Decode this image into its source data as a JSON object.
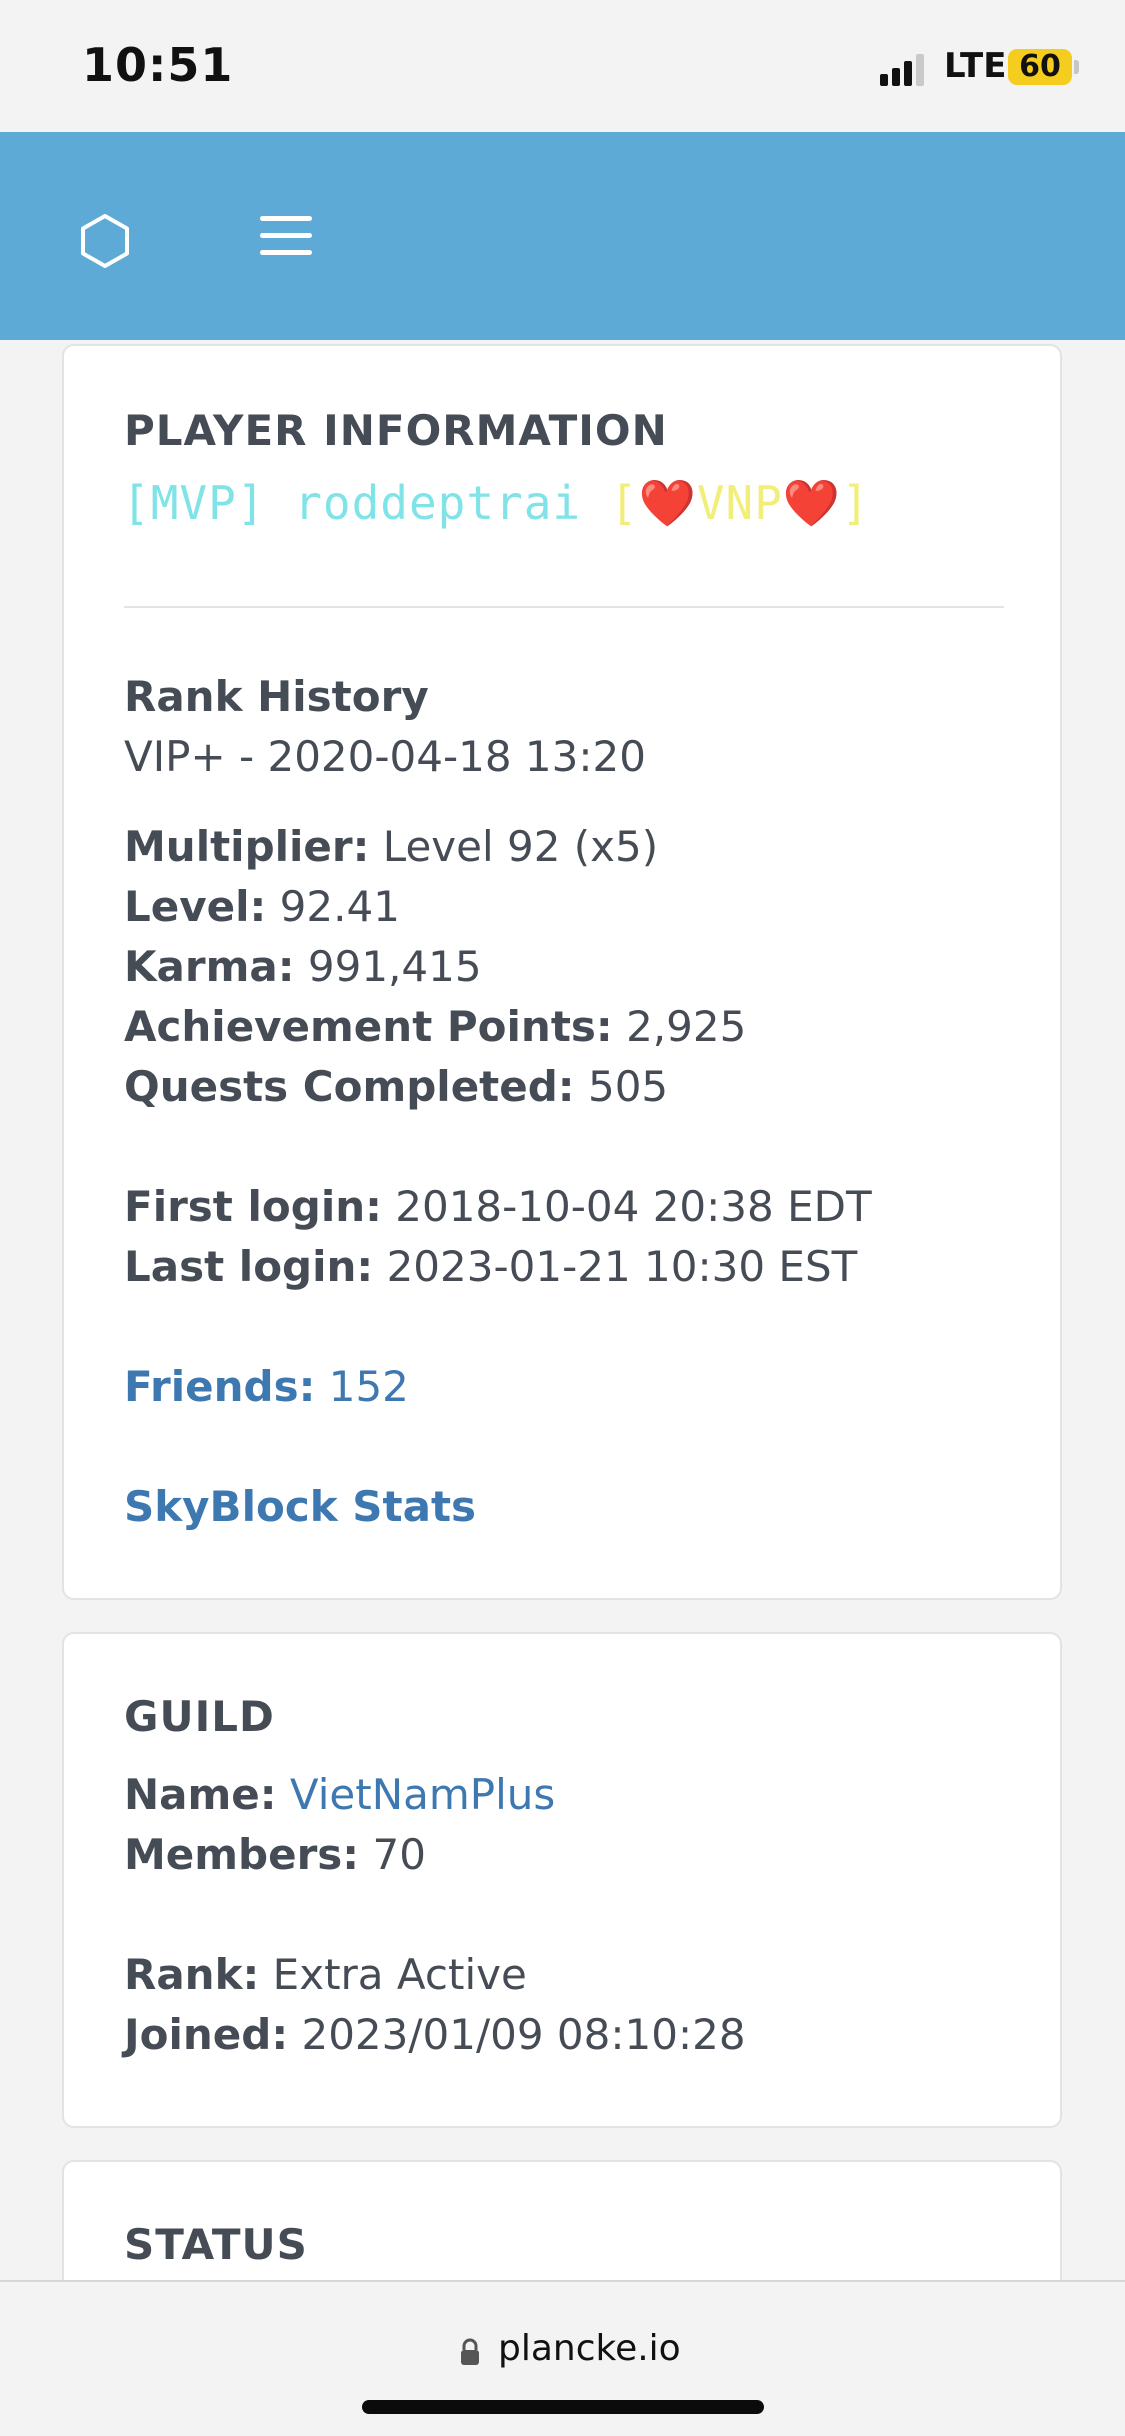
{
  "status_bar": {
    "time": "10:51",
    "network": "LTE",
    "battery": "60"
  },
  "navbar": {
    "icons": [
      "hexagon-logo-icon",
      "hamburger-menu-icon"
    ]
  },
  "player_card": {
    "title": "PLAYER INFORMATION",
    "player_name": {
      "rank": "[MVP]",
      "username": "roddeptrai",
      "guild_tag_open": "[",
      "guild_tag_text": "VNP",
      "guild_tag_close": "]",
      "heart": "❤️"
    },
    "rank_history_label": "Rank History",
    "rank_history_value": "VIP+ - 2020-04-18 13:20",
    "multiplier_label": "Multiplier:",
    "multiplier_value": "Level 92 (x5)",
    "level_label": "Level:",
    "level_value": "92.41",
    "karma_label": "Karma:",
    "karma_value": "991,415",
    "achievement_label": "Achievement Points:",
    "achievement_value": "2,925",
    "quests_label": "Quests Completed:",
    "quests_value": "505",
    "first_login_label": "First login:",
    "first_login_value": "2018-10-04 20:38 EDT",
    "last_login_label": "Last login:",
    "last_login_value": "2023-01-21 10:30 EST",
    "friends_label": "Friends:",
    "friends_value": "152",
    "skyblock_link": "SkyBlock Stats"
  },
  "guild_card": {
    "title": "GUILD",
    "name_label": "Name:",
    "name_value": "VietNamPlus",
    "members_label": "Members:",
    "members_value": "70",
    "rank_label": "Rank:",
    "rank_value": "Extra Active",
    "joined_label": "Joined:",
    "joined_value": "2023/01/09 08:10:28"
  },
  "status_card": {
    "title": "STATUS"
  },
  "browser": {
    "url": "plancke.io"
  },
  "colors": {
    "navbar": "#5daad6",
    "link": "#3d78b0",
    "mvp_aqua": "#7fe3e7",
    "guild_tag_yellow": "#f2ee7a",
    "heart_red": "#e11b2b",
    "battery_yellow": "#f5cd1e"
  }
}
